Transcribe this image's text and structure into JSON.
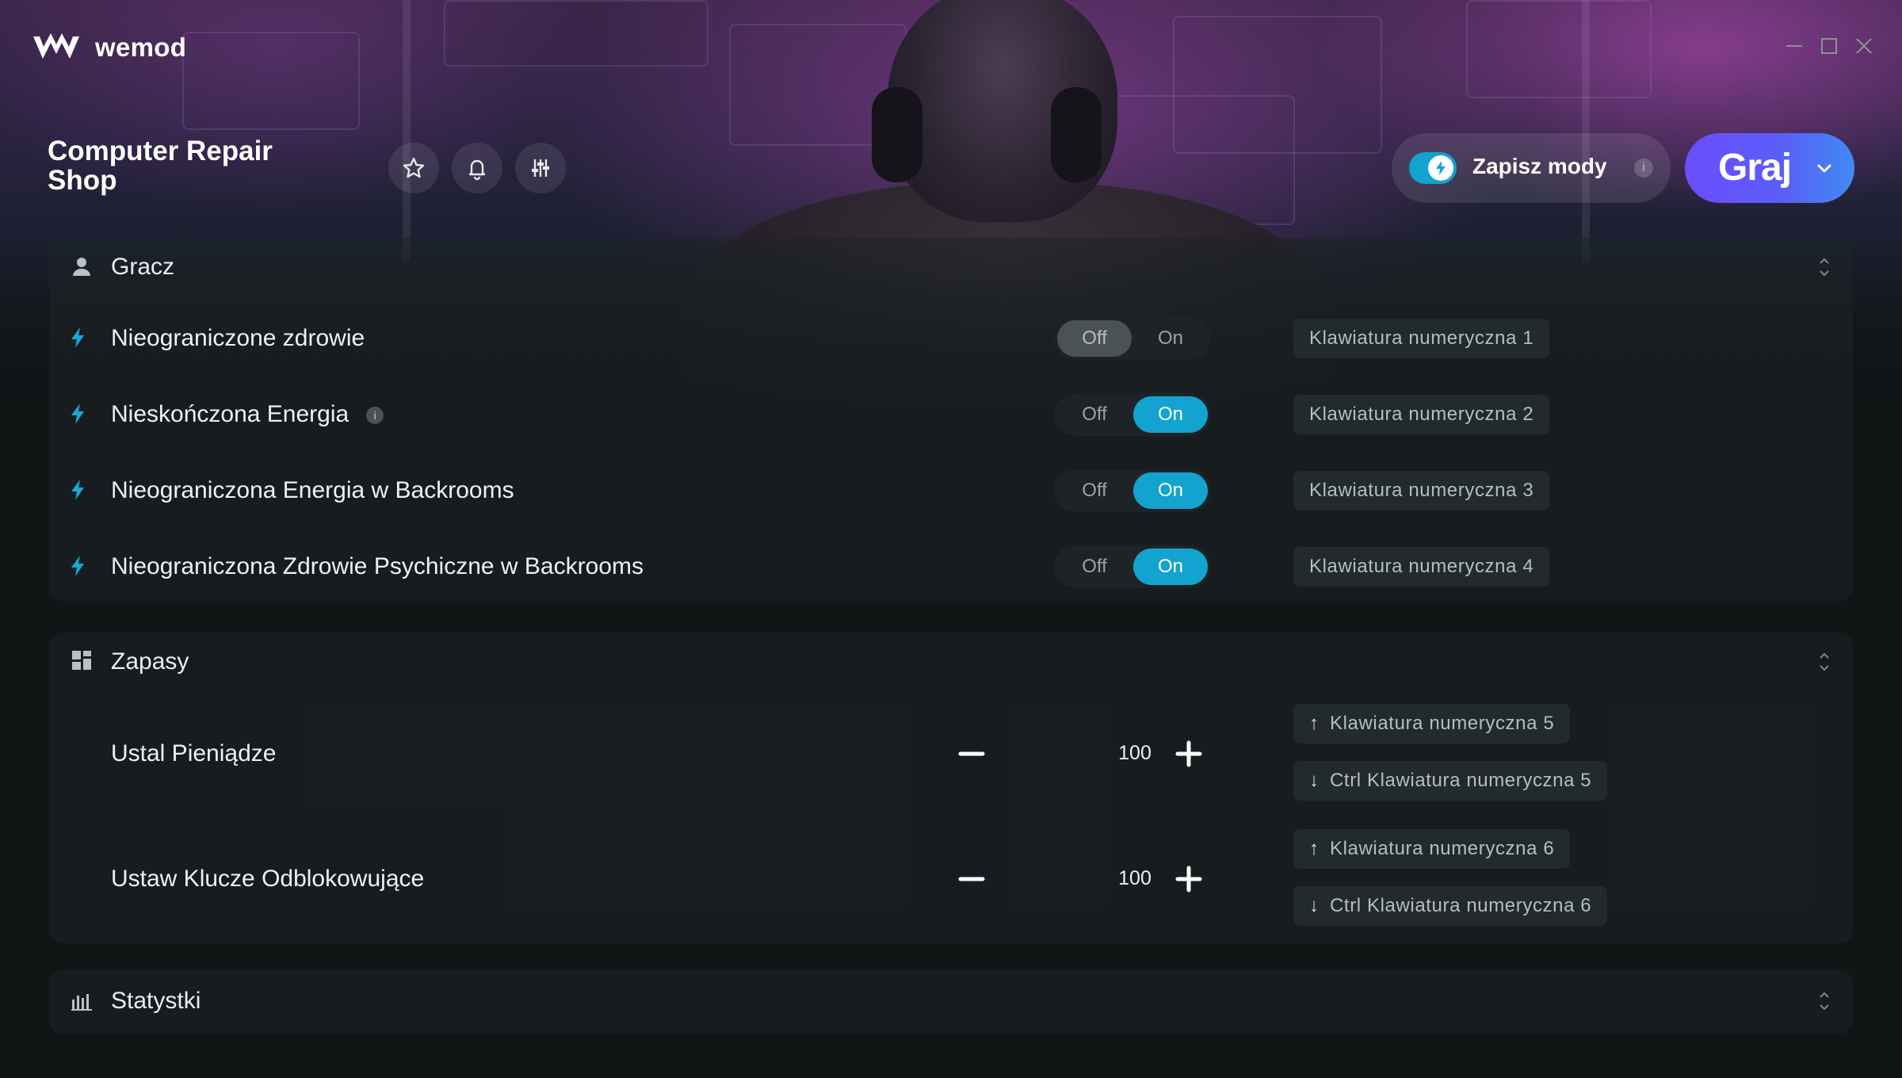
{
  "app": {
    "name": "wemod"
  },
  "window_controls": [
    "minimize-icon",
    "maximize-icon",
    "close-icon"
  ],
  "game": {
    "title": "Computer Repair Shop"
  },
  "header_buttons": [
    "star-icon",
    "bell-icon",
    "sliders-icon"
  ],
  "save_mods": {
    "label": "Zapisz mody",
    "enabled": true,
    "info": "i"
  },
  "play": {
    "label": "Graj"
  },
  "colors": {
    "accent": "#13a3cf",
    "play_start": "#6a4dff",
    "play_end": "#3f8af5",
    "background": "#101516"
  },
  "sections": {
    "player": {
      "title": "Gracz",
      "icon": "person-icon",
      "rows": [
        {
          "label": "Nieograniczone zdrowie",
          "state": "Off",
          "hotkey": "Klawiatura numeryczna 1"
        },
        {
          "label": "Nieskończona Energia",
          "state": "On",
          "hotkey": "Klawiatura numeryczna 2",
          "info": "i"
        },
        {
          "label": "Nieograniczona Energia w Backrooms",
          "state": "On",
          "hotkey": "Klawiatura numeryczna 3"
        },
        {
          "label": "Nieograniczona Zdrowie Psychiczne w Backrooms",
          "state": "On",
          "hotkey": "Klawiatura numeryczna 4"
        }
      ]
    },
    "inventory": {
      "title": "Zapasy",
      "icon": "grid-icon",
      "rows": [
        {
          "label": "Ustal Pieniądze",
          "value": "100",
          "hotkey_up": "Klawiatura numeryczna 5",
          "hotkey_down": "Ctrl Klawiatura numeryczna 5"
        },
        {
          "label": "Ustaw Klucze Odblokowujące",
          "value": "100",
          "hotkey_up": "Klawiatura numeryczna 6",
          "hotkey_down": "Ctrl Klawiatura numeryczna 6"
        }
      ]
    },
    "stats": {
      "title": "Statystki",
      "icon": "bar-chart-icon"
    }
  },
  "toggle_labels": {
    "off": "Off",
    "on": "On"
  }
}
